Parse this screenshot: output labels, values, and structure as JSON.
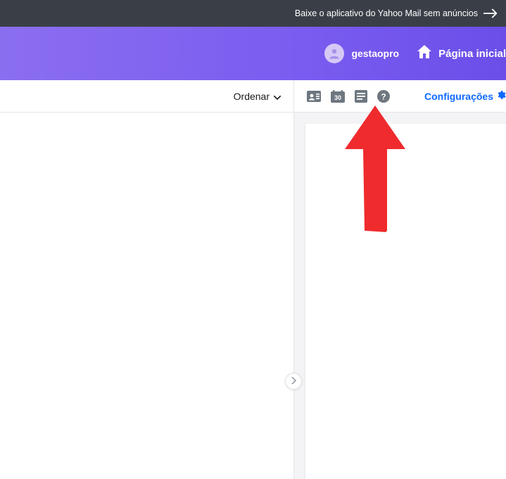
{
  "banner": {
    "text": "Baixe o aplicativo do Yahoo Mail sem anúncios"
  },
  "header": {
    "username": "gestaopro",
    "home_label": "Página inicial"
  },
  "toolbar": {
    "sort_label": "Ordenar",
    "config_label": "Configurações",
    "icons": {
      "contacts": "contacts-icon",
      "calendar": "calendar-icon",
      "calendar_day": "30",
      "notepad": "notepad-icon",
      "help": "help-icon"
    }
  },
  "annotation": {
    "arrow_color": "#ef2b2d"
  }
}
